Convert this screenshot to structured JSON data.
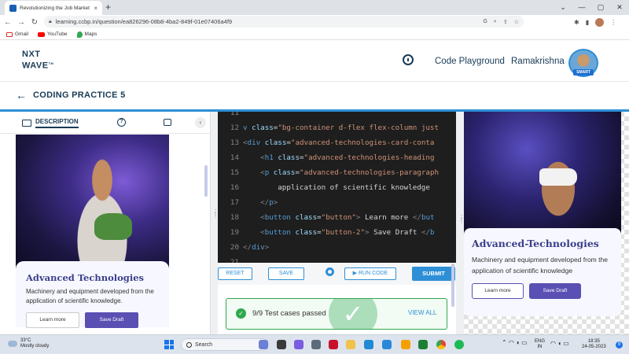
{
  "browser": {
    "tab_title": "Revolutionizing the Job Market |",
    "tab_close": "×",
    "new_tab": "+",
    "url": "learning.ccbp.in/question/ea826296-08b8-4ba2-849f-01e07406a4f9",
    "window_controls": [
      "⌄",
      "—",
      "▢",
      "✕"
    ],
    "nav": [
      "←",
      "→",
      "↻"
    ],
    "bookmarks": [
      {
        "label": "Gmail",
        "icon": "gmail-icon"
      },
      {
        "label": "YouTube",
        "icon": "youtube-icon"
      },
      {
        "label": "Maps",
        "icon": "maps-icon"
      }
    ]
  },
  "header": {
    "logo_line1": "NXT",
    "logo_line2": "WAVE",
    "logo_tm": "TM",
    "code_playground": "Code Playground",
    "user_name": "Ramakrishna",
    "badge": "SMART"
  },
  "practice": {
    "back_icon": "←",
    "title": "CODING PRACTICE 5"
  },
  "left_panel": {
    "tab_description": "DESCRIPTION",
    "help_icon_text": "?",
    "collapse_icon": "‹",
    "card": {
      "heading": "Advanced Technologies",
      "text": "Machinery and equipment developed from the application of scientific knowledge.",
      "btn_learn": "Learn more",
      "btn_save": "Save Draft"
    }
  },
  "editor": {
    "lines": [
      {
        "n": "11",
        "html": ""
      },
      {
        "n": "12",
        "html": "<span class='t-tag'>v</span> <span class='t-attr'>class</span>=<span class='t-str'>\"bg-container d-flex flex-column just</span>"
      },
      {
        "n": "13",
        "html": "<span class='t-ang'>&lt;</span><span class='t-tag'>div</span> <span class='t-attr'>class</span>=<span class='t-str'>\"advanced-technologies-card-conta</span>"
      },
      {
        "n": "14",
        "html": "    <span class='t-ang'>&lt;</span><span class='t-tag'>h1</span> <span class='t-attr'>class</span>=<span class='t-str'>\"advanced-technologies-heading</span>"
      },
      {
        "n": "15",
        "html": "    <span class='t-ang'>&lt;</span><span class='t-tag'>p</span> <span class='t-attr'>class</span>=<span class='t-str'>\"advanced-technologies-paragraph</span>"
      },
      {
        "n": "16",
        "html": "        <span class='t-txt'>application of scientific knowledge</span>"
      },
      {
        "n": "17",
        "html": "    <span class='t-ang'>&lt;/</span><span class='t-tag'>p</span><span class='t-ang'>&gt;</span>"
      },
      {
        "n": "18",
        "html": "    <span class='t-ang'>&lt;</span><span class='t-tag'>button</span> <span class='t-attr'>class</span>=<span class='t-str'>\"button\"</span><span class='t-ang'>&gt;</span> <span class='t-txt'>Learn more</span> <span class='t-ang'>&lt;/</span><span class='t-tag'>but</span>"
      },
      {
        "n": "19",
        "html": "    <span class='t-ang'>&lt;</span><span class='t-tag'>button</span> <span class='t-attr'>class</span>=<span class='t-str'>\"button-2\"</span><span class='t-ang'>&gt;</span> <span class='t-txt'>Save Draft</span> <span class='t-ang'>&lt;/</span><span class='t-tag'>b</span>"
      },
      {
        "n": "20",
        "html": "<span class='t-ang'>&lt;/</span><span class='t-tag'>div</span><span class='t-ang'>&gt;</span>"
      },
      {
        "n": "21",
        "html": ""
      }
    ],
    "btn_reset": "RESET",
    "btn_save": "SAVE",
    "btn_run": "▶ RUN CODE",
    "btn_submit": "SUBMIT",
    "test_result": "9/9 Test cases passed",
    "check_glyph": "✓",
    "view_all": "VIEW ALL"
  },
  "right_preview": {
    "heading": "Advanced-Technologies",
    "text": "Machinery and equipment developed from the application of scientific knowledge",
    "btn_learn": "Learn more",
    "btn_save": "Save Draft"
  },
  "taskbar": {
    "temp": "33°C",
    "weather": "Mostly cloudy",
    "search": "Search",
    "lang1": "ENG",
    "lang2": "IN",
    "time": "18:35",
    "date": "24-05-2023",
    "notif_count": "9",
    "tray_icons": "⌃  ◠ ◖ ▭"
  },
  "colors": {
    "brand_navy": "#183b56",
    "accent_blue": "#2d8fd5",
    "success_green": "#2fa84f",
    "button_purple": "#5a4fb3",
    "heading_indigo": "#3b3f8a"
  }
}
